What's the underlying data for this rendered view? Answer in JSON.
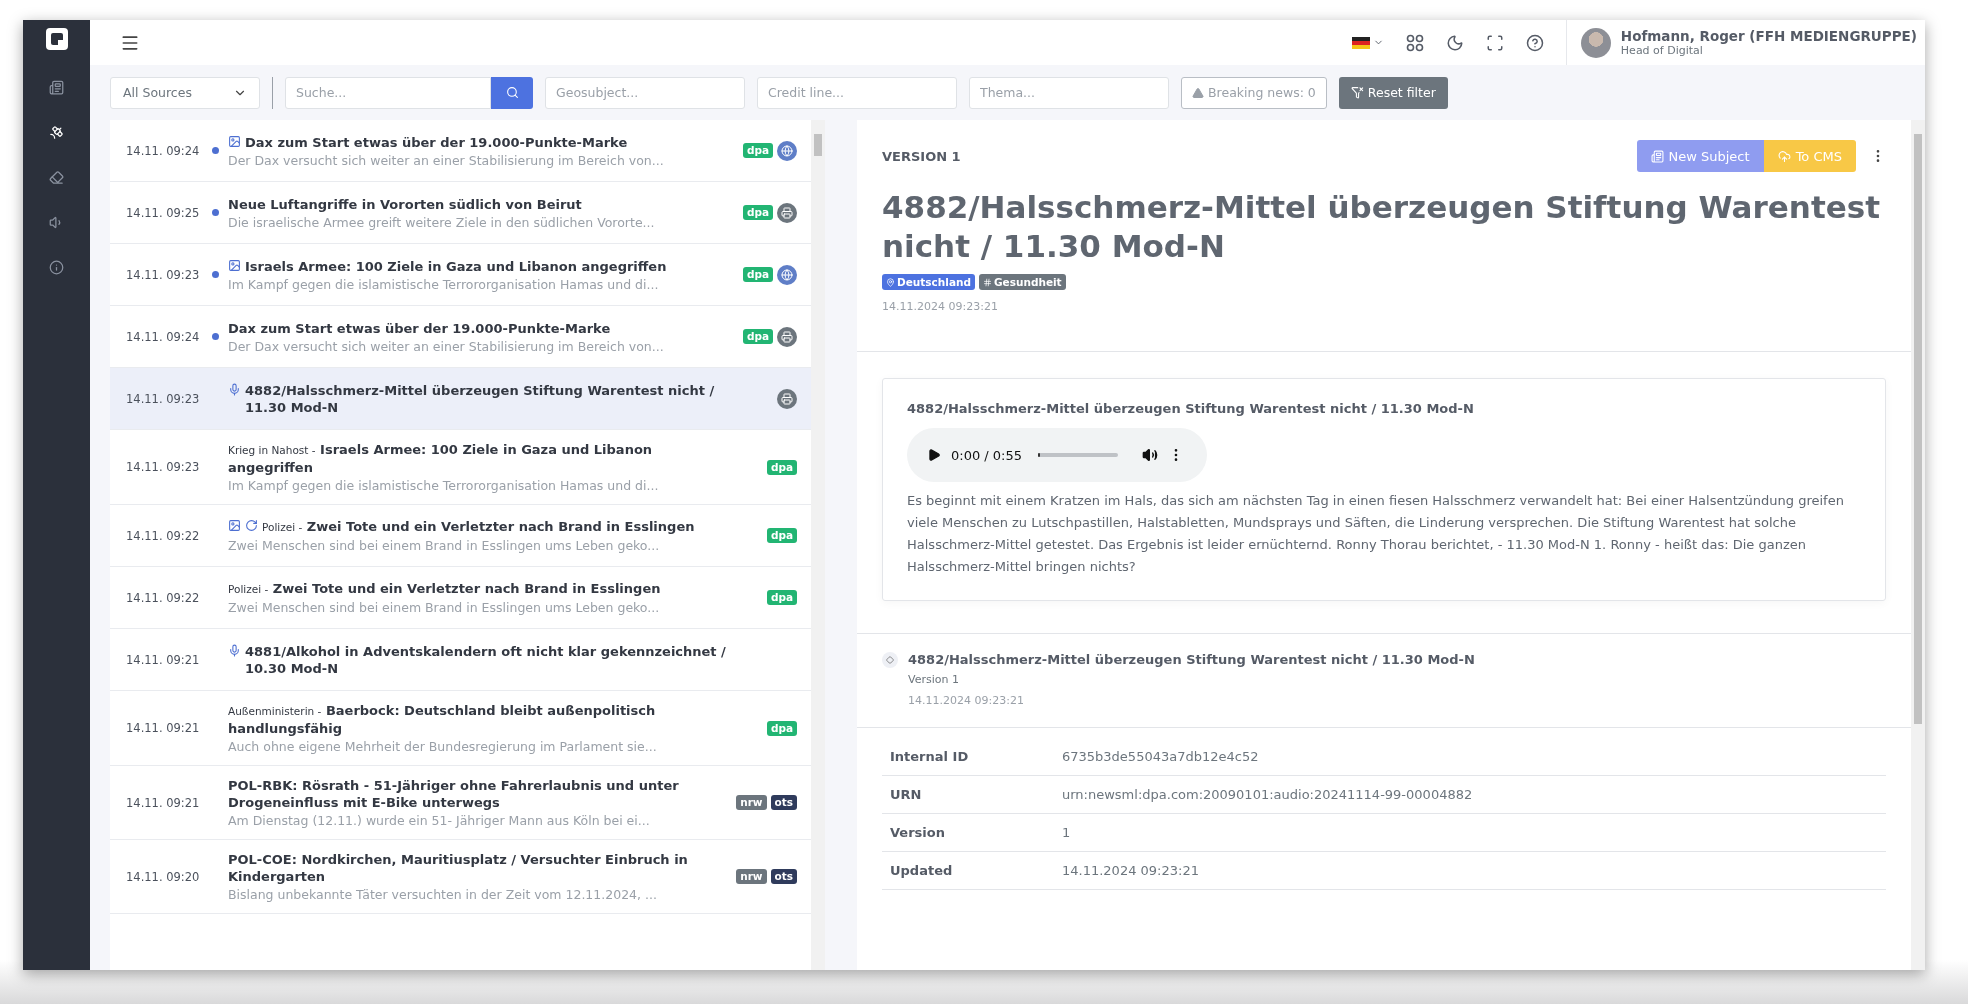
{
  "sidebar": {
    "items": [
      {
        "kind": "newspaper",
        "selected": false
      },
      {
        "kind": "satellite",
        "selected": true
      },
      {
        "kind": "eraser",
        "selected": false
      },
      {
        "kind": "speaker",
        "selected": false
      },
      {
        "kind": "info",
        "selected": false
      }
    ]
  },
  "topbar": {
    "user": {
      "name": "Hofmann, Roger (FFH MEDIENGRUPPE)",
      "role": "Head of Digital"
    }
  },
  "filters": {
    "source": "All Sources",
    "search": {
      "placeholder": "Suche..."
    },
    "geosubject": {
      "placeholder": "Geosubject..."
    },
    "credit_line": {
      "placeholder": "Credit line..."
    },
    "thema": {
      "placeholder": "Thema..."
    },
    "breaking_news": "Breaking news: 0",
    "reset": "Reset filter"
  },
  "news_list": [
    {
      "time": "14.11. 09:24",
      "unread": true,
      "media": [
        {
          "kind": "image"
        }
      ],
      "title": "Dax zum Start etwas über der 19.000-Punkte-Marke",
      "teaser": "Der Dax versucht sich weiter an einer Stabilisierung im Bereich von...",
      "badges": [
        {
          "label": "dpa",
          "color": "#22b573"
        }
      ],
      "channel": {
        "kind": "globe"
      },
      "selected": false
    },
    {
      "time": "14.11. 09:25",
      "unread": true,
      "title": "Neue Luftangriffe in Vororten südlich von Beirut",
      "teaser": "Die israelische Armee greift weitere Ziele in den südlichen Vororte...",
      "badges": [
        {
          "label": "dpa",
          "color": "#22b573"
        }
      ],
      "channel": {
        "kind": "printer"
      },
      "selected": false
    },
    {
      "time": "14.11. 09:23",
      "unread": true,
      "media": [
        {
          "kind": "image"
        }
      ],
      "title": "Israels Armee: 100 Ziele in Gaza und Libanon angegriffen",
      "teaser": "Im Kampf gegen die islamistische Terrororganisation Hamas und di...",
      "badges": [
        {
          "label": "dpa",
          "color": "#22b573"
        }
      ],
      "channel": {
        "kind": "globe"
      },
      "selected": false
    },
    {
      "time": "14.11. 09:24",
      "unread": true,
      "title": "Dax zum Start etwas über der 19.000-Punkte-Marke",
      "teaser": "Der Dax versucht sich weiter an einer Stabilisierung im Bereich von...",
      "badges": [
        {
          "label": "dpa",
          "color": "#22b573"
        }
      ],
      "channel": {
        "kind": "printer"
      },
      "selected": false
    },
    {
      "time": "14.11. 09:23",
      "unread": false,
      "media": [
        {
          "kind": "mic"
        }
      ],
      "title": "4882/Halsschmerz-Mittel überzeugen Stiftung Warentest nicht / 11.30 Mod-N",
      "channel": {
        "kind": "printer"
      },
      "selected": true
    },
    {
      "time": "14.11. 09:23",
      "unread": false,
      "category": "Krieg in Nahost -",
      "title": "Israels Armee: 100 Ziele in Gaza und Libanon angegriffen",
      "teaser": "Im Kampf gegen die islamistische Terrororganisation Hamas und di...",
      "badges": [
        {
          "label": "dpa",
          "color": "#22b573"
        }
      ],
      "selected": false
    },
    {
      "time": "14.11. 09:22",
      "unread": false,
      "media": [
        {
          "kind": "image"
        },
        {
          "kind": "refresh"
        }
      ],
      "category": "Polizei -",
      "title": "Zwei Tote und ein Verletzter nach Brand in Esslingen",
      "teaser": "Zwei Menschen sind bei einem Brand in Esslingen ums Leben geko...",
      "badges": [
        {
          "label": "dpa",
          "color": "#22b573"
        }
      ],
      "selected": false
    },
    {
      "time": "14.11. 09:22",
      "unread": false,
      "category": "Polizei -",
      "title": "Zwei Tote und ein Verletzter nach Brand in Esslingen",
      "teaser": "Zwei Menschen sind bei einem Brand in Esslingen ums Leben geko...",
      "badges": [
        {
          "label": "dpa",
          "color": "#22b573"
        }
      ],
      "selected": false
    },
    {
      "time": "14.11. 09:21",
      "unread": false,
      "media": [
        {
          "kind": "mic"
        }
      ],
      "title": "4881/Alkohol in Adventskalendern oft nicht klar gekennzeichnet / 10.30 Mod-N",
      "selected": false
    },
    {
      "time": "14.11. 09:21",
      "unread": false,
      "category": "Außenministerin -",
      "title": "Baerbock: Deutschland bleibt außenpolitisch handlungsfähig",
      "teaser": "Auch ohne eigene Mehrheit der Bundesregierung im Parlament sie...",
      "badges": [
        {
          "label": "dpa",
          "color": "#22b573"
        }
      ],
      "selected": false
    },
    {
      "time": "14.11. 09:21",
      "unread": false,
      "title": "POL-RBK: Rösrath - 51-Jähriger ohne Fahrerlaubnis und unter Drogeneinfluss mit E-Bike unterwegs",
      "teaser": "Am Dienstag (12.11.) wurde ein 51- Jähriger Mann aus Köln bei ei...",
      "badges": [
        {
          "label": "nrw",
          "color": "#6c757d"
        },
        {
          "label": "ots",
          "color": "#2f3b5c"
        }
      ],
      "selected": false
    },
    {
      "time": "14.11. 09:20",
      "unread": false,
      "title": "POL-COE: Nordkirchen, Mauritiusplatz / Versuchter Einbruch in Kindergarten",
      "teaser": "Bislang unbekannte Täter versuchten in der Zeit vom 12.11.2024, ...",
      "badges": [
        {
          "label": "nrw",
          "color": "#6c757d"
        },
        {
          "label": "ots",
          "color": "#2f3b5c"
        }
      ],
      "selected": false
    }
  ],
  "detail": {
    "version_label": "VERSION 1",
    "buttons": {
      "new_subject": "New Subject",
      "to_cms": "To CMS"
    },
    "title": "4882/Halsschmerz-Mittel überzeugen Stiftung Warentest nicht / 11.30 Mod-N",
    "tags": [
      {
        "kind": "place",
        "label": "Deutschland"
      },
      {
        "kind": "topic",
        "label": "Gesundheit"
      }
    ],
    "date": "14.11.2024 09:23:21",
    "audio_card": {
      "title": "4882/Halsschmerz-Mittel überzeugen Stiftung Warentest nicht / 11.30 Mod-N",
      "player": {
        "time": "0:00 / 0:55",
        "level": 0.03
      },
      "text": "Es beginnt mit einem Kratzen im Hals, das sich am nächsten Tag in einen fiesen Halsschmerz verwandelt hat: Bei einer Halsentzündung greifen viele Menschen zu Lutschpastillen, Halstabletten, Mundsprays und Säften, die Linderung versprechen. Die Stiftung Warentest hat solche Halsschmerz-Mittel getestet. Das Ergebnis ist leider ernüchternd. Ronny Thorau berichtet, - 11.30 Mod-N 1. Ronny - heißt das: Die ganzen Halsschmerz-Mittel bringen nichts?"
    },
    "history": {
      "title": "4882/Halsschmerz-Mittel überzeugen Stiftung Warentest nicht / 11.30 Mod-N",
      "version": "Version 1",
      "date": "14.11.2024 09:23:21"
    },
    "properties": [
      {
        "label": "Internal ID",
        "value": "6735b3de55043a7db12e4c52"
      },
      {
        "label": "URN",
        "value": "urn:newsml:dpa.com:20090101:audio:20241114-99-00004882"
      },
      {
        "label": "Version",
        "value": "1"
      },
      {
        "label": "Updated",
        "value": "14.11.2024 09:23:21"
      }
    ]
  }
}
